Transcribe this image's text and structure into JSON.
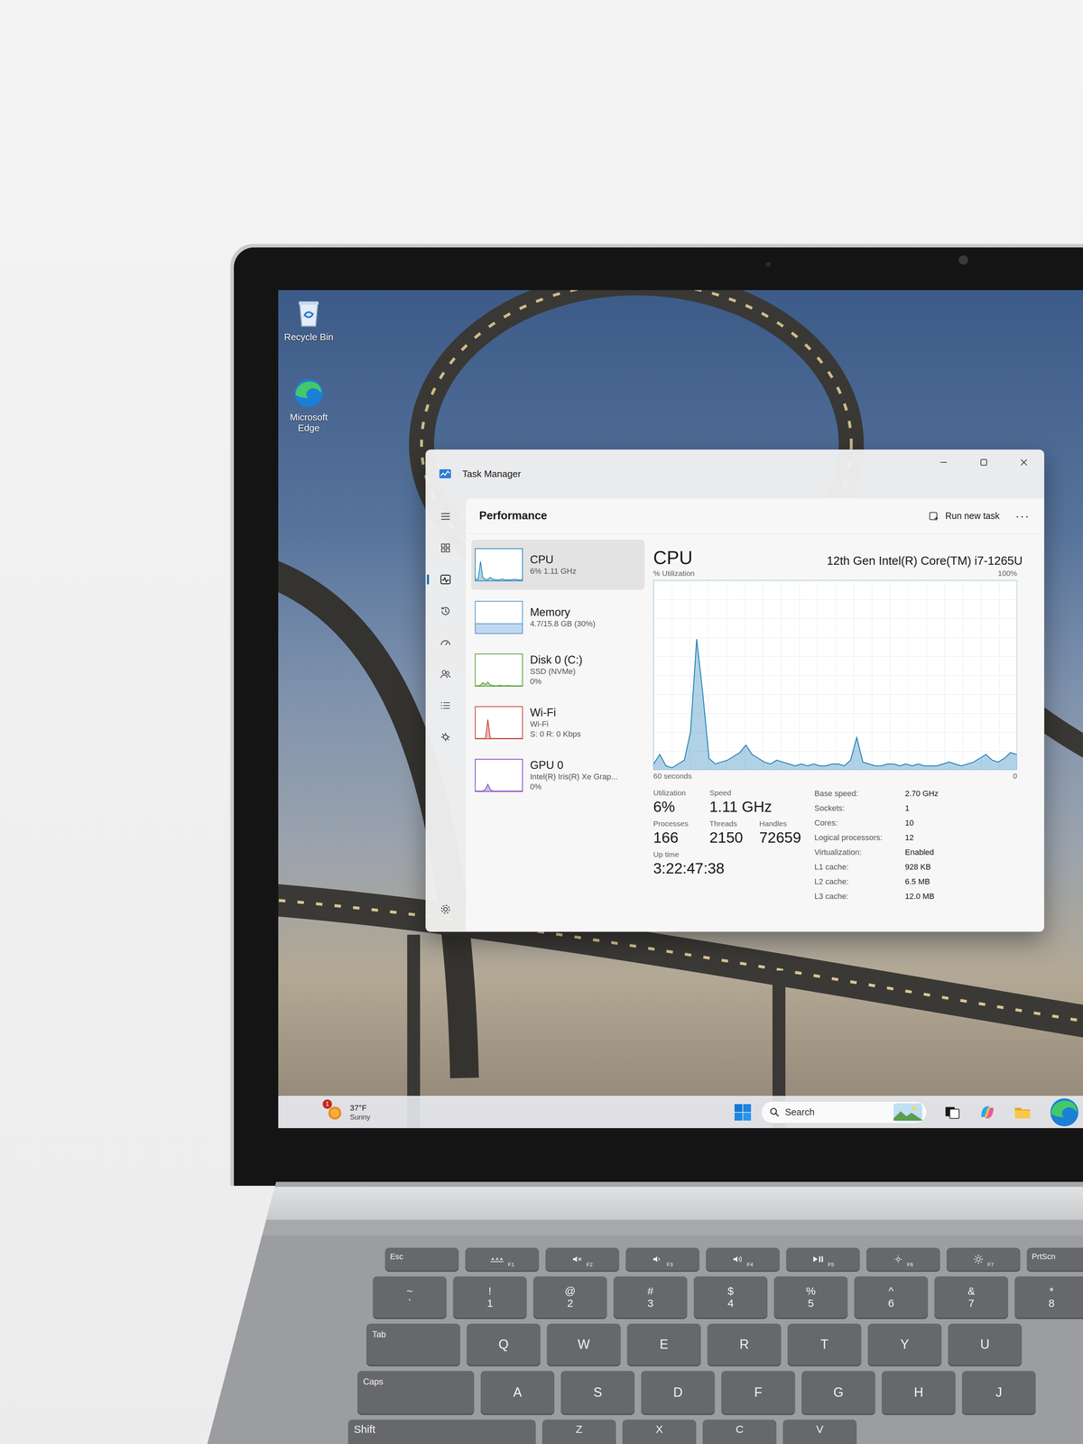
{
  "desktop": {
    "icons": [
      {
        "label": "Recycle Bin",
        "kind": "recycle"
      },
      {
        "label": "Microsoft Edge",
        "kind": "edge"
      }
    ]
  },
  "window": {
    "title": "Task Manager"
  },
  "nav": [
    {
      "kind": "menu",
      "selected": false
    },
    {
      "kind": "processes",
      "selected": false
    },
    {
      "kind": "performance",
      "selected": true
    },
    {
      "kind": "history",
      "selected": false
    },
    {
      "kind": "startup",
      "selected": false
    },
    {
      "kind": "users",
      "selected": false
    },
    {
      "kind": "details",
      "selected": false
    },
    {
      "kind": "services",
      "selected": false
    },
    {
      "kind": "settings",
      "selected": false
    }
  ],
  "header": {
    "title": "Performance",
    "run_task": "Run new task",
    "more": "···"
  },
  "sidebar": {
    "items": [
      {
        "name": "CPU",
        "lines": [
          "6% 1.11 GHz"
        ],
        "selected": true,
        "color": "#1f7fb6",
        "values": [
          5,
          3,
          60,
          8,
          4,
          3,
          10,
          4,
          3,
          2,
          3,
          5,
          2,
          3,
          2,
          3,
          4,
          3,
          2,
          3
        ]
      },
      {
        "name": "Memory",
        "lines": [
          "4.7/15.8 GB (30%)"
        ],
        "selected": false,
        "color": "#4a8fd0",
        "values": [
          30,
          30,
          30,
          30,
          30,
          30,
          30,
          30,
          30,
          30,
          30,
          30,
          30,
          30,
          30,
          30,
          30,
          30,
          30,
          30
        ]
      },
      {
        "name": "Disk 0 (C:)",
        "lines": [
          "SSD (NVMe)",
          "0%"
        ],
        "selected": false,
        "color": "#4c9a2a",
        "values": [
          0,
          0,
          2,
          10,
          4,
          12,
          3,
          1,
          0,
          0,
          2,
          0,
          0,
          1,
          0,
          0,
          0,
          0,
          0,
          0
        ]
      },
      {
        "name": "Wi-Fi",
        "lines": [
          "Wi-Fi",
          "S: 0 R: 0 Kbps"
        ],
        "selected": false,
        "color": "#c0392b",
        "values": [
          0,
          0,
          0,
          0,
          0,
          60,
          0,
          0,
          0,
          0,
          0,
          0,
          0,
          0,
          0,
          0,
          0,
          0,
          0,
          0
        ]
      },
      {
        "name": "GPU 0",
        "lines": [
          "Intel(R) Iris(R) Xe Grap...",
          "0%"
        ],
        "selected": false,
        "color": "#7b3fc4",
        "values": [
          0,
          0,
          0,
          0,
          6,
          22,
          5,
          0,
          0,
          0,
          0,
          0,
          0,
          0,
          0,
          0,
          0,
          0,
          0,
          0
        ]
      }
    ]
  },
  "main": {
    "title": "CPU",
    "model": "12th Gen Intel(R) Core(TM) i7-1265U",
    "y_label": "% Utilization",
    "y_max": "100%",
    "x_label": "60 seconds",
    "y_min": "0"
  },
  "chart": {
    "series": [
      {
        "color": "#1f7fb6",
        "values": [
          3,
          8,
          2,
          1,
          3,
          5,
          20,
          69,
          40,
          6,
          3,
          4,
          5,
          7,
          9,
          13,
          8,
          6,
          4,
          3,
          5,
          4,
          3,
          2,
          3,
          2,
          3,
          2,
          2,
          3,
          3,
          2,
          5,
          17,
          4,
          3,
          2,
          2,
          3,
          3,
          2,
          3,
          2,
          3,
          2,
          2,
          2,
          3,
          4,
          3,
          2,
          3,
          4,
          6,
          8,
          5,
          4,
          6,
          9,
          8
        ]
      }
    ]
  },
  "stats": [
    [
      {
        "label": "Utilization",
        "value": "6%"
      },
      {
        "label": "Speed",
        "value": "1.11 GHz"
      }
    ],
    [
      {
        "label": "Processes",
        "value": "166"
      },
      {
        "label": "Threads",
        "value": "2150"
      },
      {
        "label": "Handles",
        "value": "72659"
      }
    ],
    [
      {
        "label": "Up time",
        "value": "3:22:47:38"
      }
    ]
  ],
  "details": [
    {
      "label": "Base speed:",
      "value": "2.70 GHz"
    },
    {
      "label": "Sockets:",
      "value": "1"
    },
    {
      "label": "Cores:",
      "value": "10"
    },
    {
      "label": "Logical processors:",
      "value": "12"
    },
    {
      "label": "Virtualization:",
      "value": "Enabled"
    },
    {
      "label": "L1 cache:",
      "value": "928 KB"
    },
    {
      "label": "L2 cache:",
      "value": "6.5 MB"
    },
    {
      "label": "L3 cache:",
      "value": "12.0 MB"
    }
  ],
  "taskbar": {
    "weather": {
      "temp": "37°F",
      "condition": "Sunny",
      "badge": "1"
    },
    "search": {
      "label": "Search"
    },
    "apps": [
      {
        "kind": "taskview"
      },
      {
        "kind": "copilot"
      },
      {
        "kind": "explorer"
      },
      {
        "kind": "edge"
      },
      {
        "kind": "store"
      }
    ]
  },
  "keyboard": {
    "rows": [
      [
        {
          "kind": "label",
          "text": "Esc"
        },
        {
          "kind": "fn-backlight",
          "text": "F1"
        },
        {
          "kind": "fn-mute",
          "text": "F2"
        },
        {
          "kind": "fn-voldown",
          "text": "F3"
        },
        {
          "kind": "fn-volup",
          "text": "F4"
        },
        {
          "kind": "fn-play",
          "text": "F5"
        },
        {
          "kind": "fn-dim",
          "text": "F6"
        },
        {
          "kind": "fn-bright",
          "text": "F7"
        },
        {
          "kind": "label",
          "text": "PrtScn"
        }
      ],
      [
        {
          "kind": "dual",
          "top": "~",
          "bottom": "`"
        },
        {
          "kind": "dual",
          "top": "!",
          "bottom": "1"
        },
        {
          "kind": "dual",
          "top": "@",
          "bottom": "2"
        },
        {
          "kind": "dual",
          "top": "#",
          "bottom": "3"
        },
        {
          "kind": "dual",
          "top": "$",
          "bottom": "4"
        },
        {
          "kind": "dual",
          "top": "%",
          "bottom": "5"
        },
        {
          "kind": "dual",
          "top": "^",
          "bottom": "6"
        },
        {
          "kind": "dual",
          "top": "&",
          "bottom": "7"
        },
        {
          "kind": "dual",
          "top": "*",
          "bottom": "8"
        }
      ],
      [
        {
          "kind": "wide",
          "text": "Tab"
        },
        {
          "kind": "letter",
          "text": "Q"
        },
        {
          "kind": "letter",
          "text": "W"
        },
        {
          "kind": "letter",
          "text": "E"
        },
        {
          "kind": "letter",
          "text": "R"
        },
        {
          "kind": "letter",
          "text": "T"
        },
        {
          "kind": "letter",
          "text": "Y"
        },
        {
          "kind": "letter",
          "text": "U"
        }
      ],
      [
        {
          "kind": "wide",
          "text": "Caps"
        },
        {
          "kind": "letter",
          "text": "A"
        },
        {
          "kind": "letter",
          "text": "S"
        },
        {
          "kind": "letter",
          "text": "D"
        },
        {
          "kind": "letter",
          "text": "F"
        },
        {
          "kind": "letter",
          "text": "G"
        },
        {
          "kind": "letter",
          "text": "H"
        },
        {
          "kind": "letter",
          "text": "J"
        }
      ],
      [
        {
          "kind": "wide",
          "text": "Shift"
        },
        {
          "kind": "letter",
          "text": "Z"
        },
        {
          "kind": "letter",
          "text": "X"
        },
        {
          "kind": "letter",
          "text": "C"
        },
        {
          "kind": "letter",
          "text": "V"
        }
      ]
    ]
  }
}
